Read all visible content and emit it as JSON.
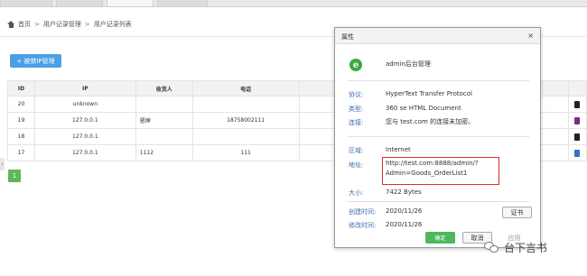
{
  "breadcrumb": {
    "items": [
      "首页",
      "用户记录管理",
      "用户记录列表"
    ],
    "separator": ">"
  },
  "toolbar": {
    "ban_ip_button": "+ 被禁IP管理"
  },
  "table": {
    "columns": [
      "ID",
      "IP",
      "收货人",
      "电话"
    ],
    "rows": [
      {
        "id": "20",
        "ip": "unknown",
        "receiver": "",
        "phone": ""
      },
      {
        "id": "19",
        "ip": "127.0.0.1",
        "receiver": "罂婶",
        "phone": "18758002111"
      },
      {
        "id": "18",
        "ip": "127.0.0.1",
        "receiver": "",
        "phone": ""
      },
      {
        "id": "17",
        "ip": "127.0.0.1",
        "receiver": "1112",
        "phone": "111"
      }
    ],
    "row_icon_colors": [
      "#222222",
      "#7b2c8a",
      "#222222",
      "#2f74c0"
    ]
  },
  "pagination": {
    "current_page": "1"
  },
  "dialog": {
    "title": "属性",
    "close_glyph": "×",
    "file_name": "admin后台管理",
    "fields": {
      "protocol_label": "协议:",
      "protocol_value": "HyperText Transfer Protocol",
      "type_label": "类型:",
      "type_value": "360 se HTML Document",
      "connection_label": "连接:",
      "connection_value": "您与 test.com 的连接未加密。",
      "zone_label": "区域:",
      "zone_value": "Internet",
      "address_label": "地址:",
      "address_line1": "http://test.com:8888/admin/?",
      "address_line2": "Admin=Goods_OrderList1",
      "size_label": "大小:",
      "size_value": "7422 Bytes",
      "created_label": "创建时间:",
      "created_value": "2020/11/26",
      "modified_label": "修改时间:",
      "modified_value": "2020/11/26"
    },
    "cert_button": "证书",
    "ok_button": "确定",
    "cancel_button": "取消",
    "apply_button": "应用",
    "highlight_color": "#d9302c"
  },
  "watermark": {
    "text": "台下言书"
  }
}
